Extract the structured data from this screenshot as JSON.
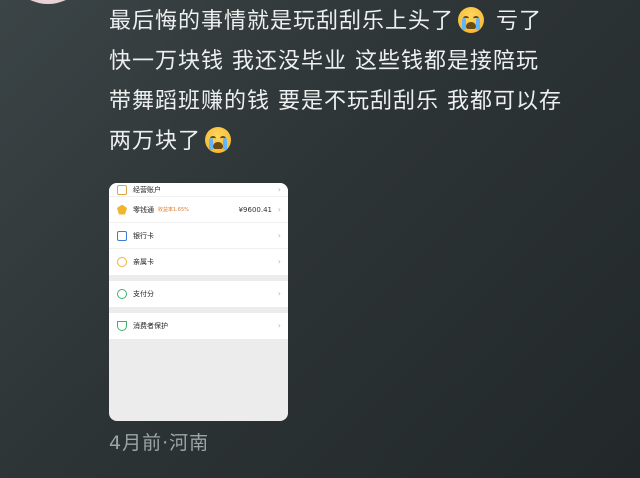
{
  "comment": {
    "line1": "最后悔的事情就是玩刮刮乐上头了",
    "line1_after": "亏了",
    "line2": "快一万块钱 我还没毕业 这些钱都是接陪玩",
    "line3": "带舞蹈班赚的钱 要是不玩刮刮乐 我都可以存",
    "line4": "两万块了",
    "emoji": "loudly-crying-face-emoji"
  },
  "screenshot": {
    "rows": [
      {
        "label": "经营账户",
        "icon": "account-icon"
      },
      {
        "label": "零钱通",
        "badge": "收益率1.65%",
        "value": "¥9600.41",
        "icon": "lingqiantong-icon"
      },
      {
        "label": "银行卡",
        "icon": "bank-card-icon"
      },
      {
        "label": "亲属卡",
        "icon": "family-card-icon"
      },
      {
        "label": "支付分",
        "icon": "pay-score-icon"
      },
      {
        "label": "消费者保护",
        "icon": "consumer-protection-icon"
      }
    ],
    "chevron": "›"
  },
  "meta": {
    "time_location": "4月前·河南"
  },
  "colors": {
    "background": "#2d3436",
    "text": "#eef0f0",
    "meta_text": "#9ca4a6"
  }
}
